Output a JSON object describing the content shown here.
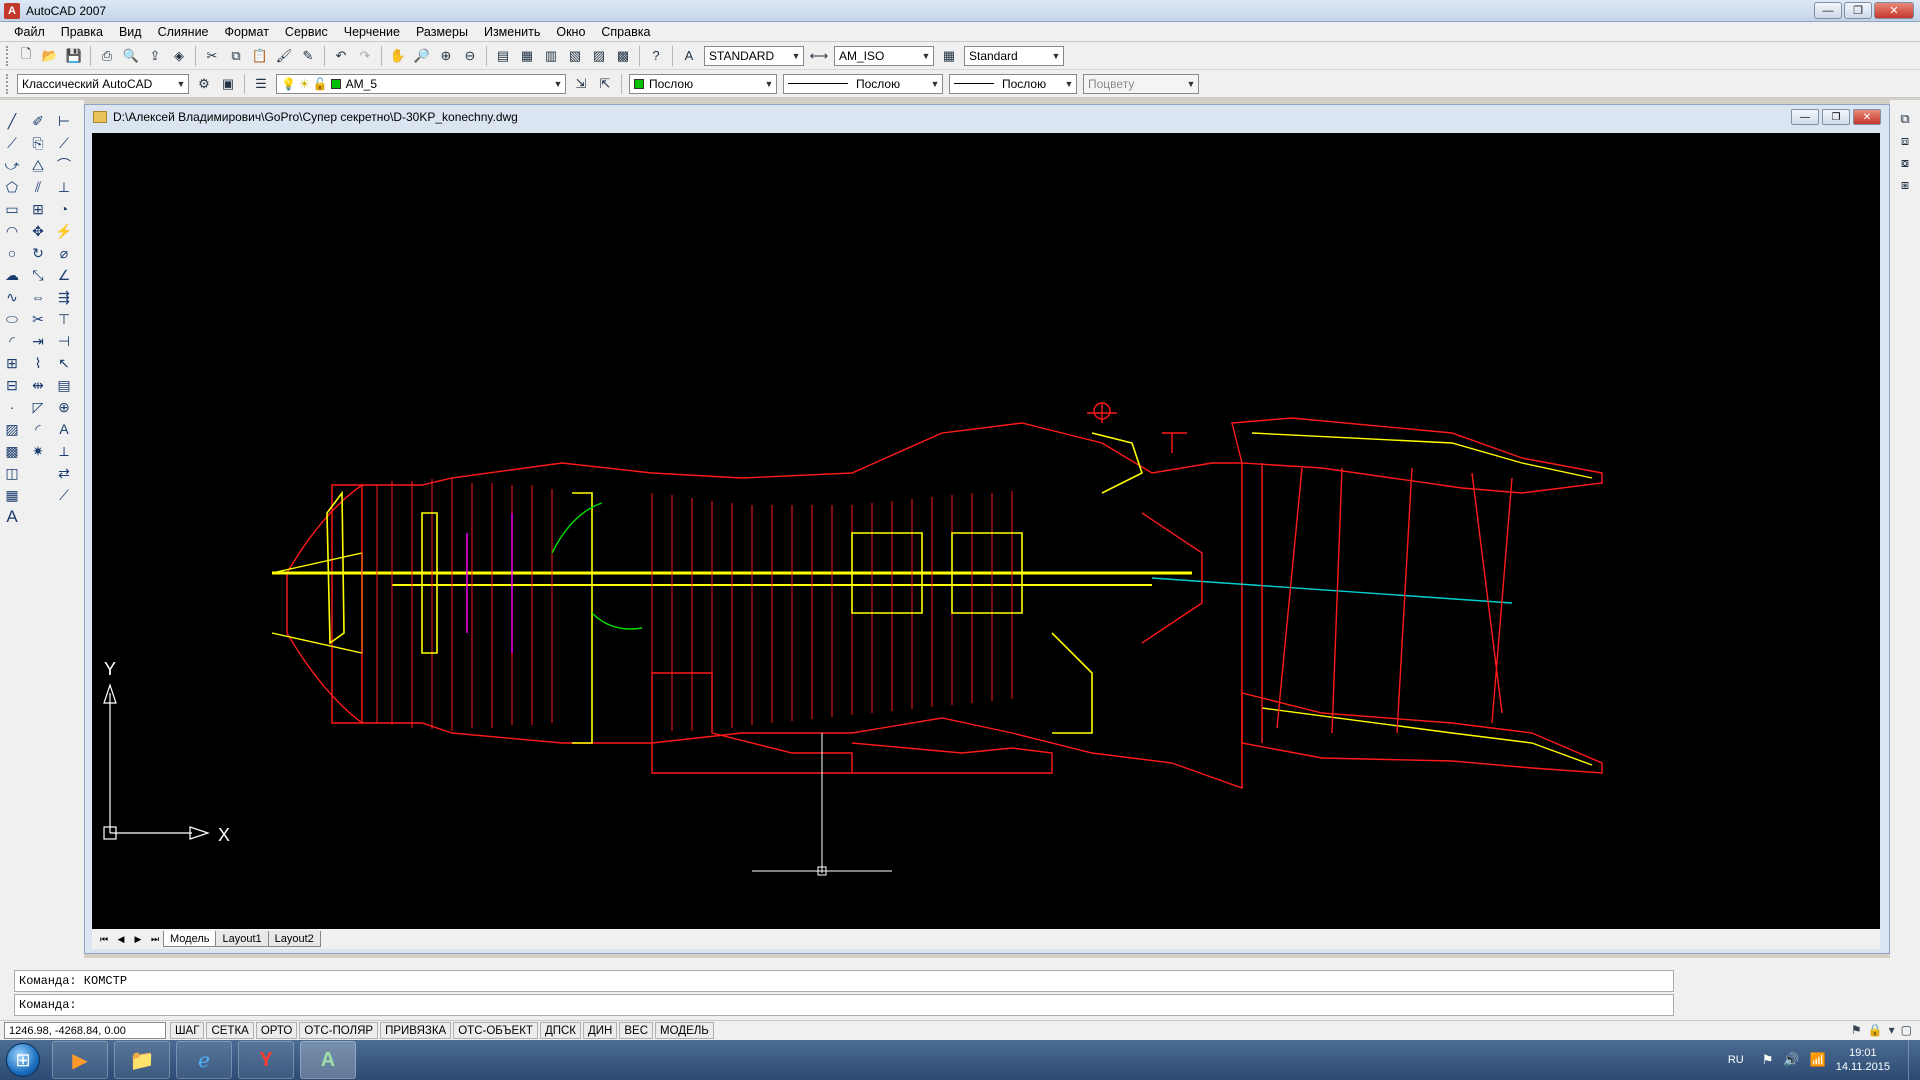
{
  "window": {
    "title": "AutoCAD 2007",
    "app_icon": "A"
  },
  "menu": [
    "Файл",
    "Правка",
    "Вид",
    "Слияние",
    "Формат",
    "Сервис",
    "Черчение",
    "Размеры",
    "Изменить",
    "Окно",
    "Справка"
  ],
  "toolbar1": {
    "text_style": "STANDARD",
    "dim_style": "AM_ISO",
    "table_style": "Standard"
  },
  "toolbar2": {
    "workspace": "Классический AutoCAD",
    "layer": "AM_5",
    "color": "Послою",
    "linetype": "Послою",
    "lineweight": "Послою",
    "plotstyle": "Поцвету"
  },
  "drawing": {
    "path": "D:\\Алексей Владимирович\\GoPro\\Супер секретно\\D-30KP_konechny.dwg",
    "ucs_x": "X",
    "ucs_y": "Y",
    "tabs": [
      "Модель",
      "Layout1",
      "Layout2"
    ]
  },
  "command": {
    "history": "Команда: КОМСТР",
    "prompt": "Команда:"
  },
  "status": {
    "coords": "1246.98, -4268.84, 0.00",
    "buttons": [
      "ШАГ",
      "СЕТКА",
      "ОРТО",
      "ОТС-ПОЛЯР",
      "ПРИВЯЗКА",
      "ОТС-ОБЪЕКТ",
      "ДПСК",
      "ДИН",
      "ВЕС",
      "МОДЕЛЬ"
    ]
  },
  "taskbar": {
    "lang": "RU",
    "time": "19:01",
    "date": "14.11.2015"
  },
  "colors": {
    "canvas": "#000000",
    "drawing_red": "#ff1a1a",
    "drawing_yellow": "#ffff00",
    "drawing_cyan": "#00d0d0"
  }
}
